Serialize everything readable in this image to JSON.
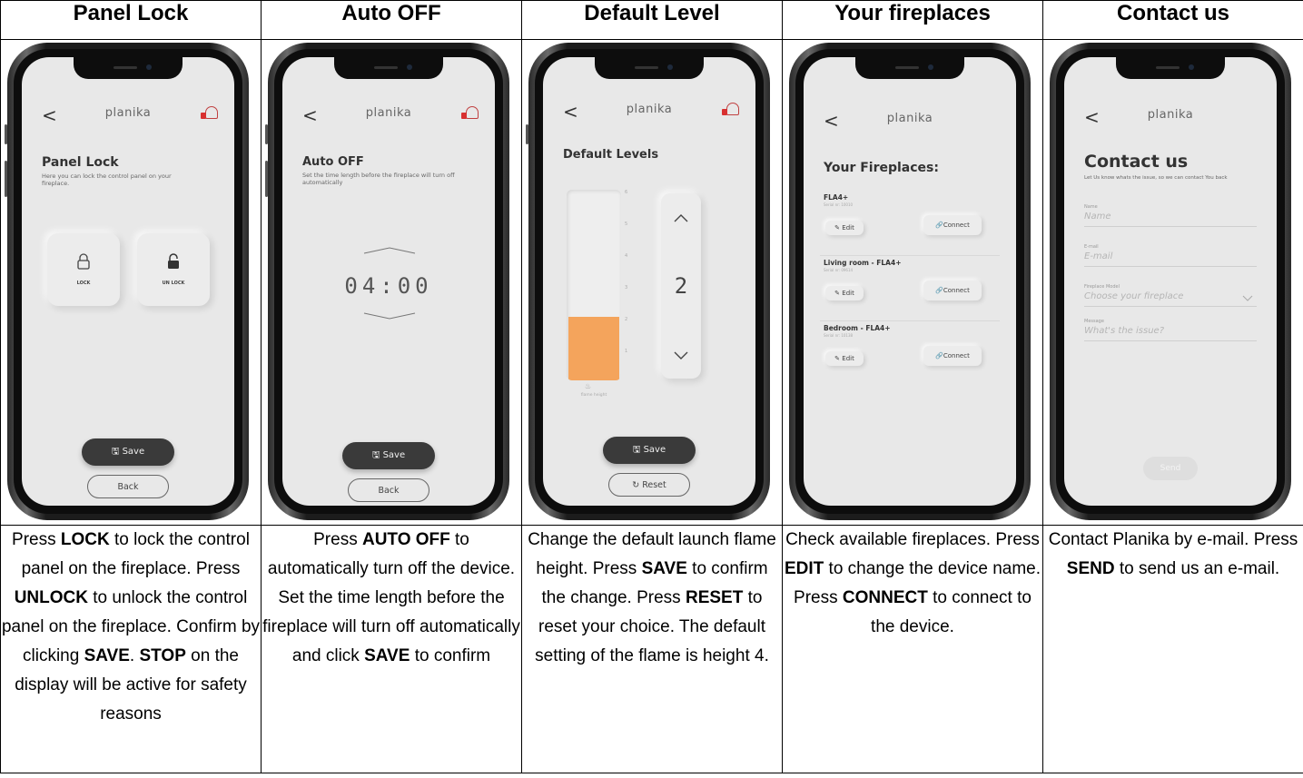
{
  "headers": [
    "Panel Lock",
    "Auto OFF",
    "Default Level",
    "Your fireplaces",
    "Contact us"
  ],
  "app": {
    "brand": "planika",
    "back_glyph": "<"
  },
  "panel_lock": {
    "title": "Panel Lock",
    "subtitle": "Here you can lock the control panel on your fireplace.",
    "lock_label": "LOCK",
    "unlock_label": "UN LOCK",
    "save": "Save",
    "back": "Back"
  },
  "auto_off": {
    "title": "Auto OFF",
    "subtitle": "Set the time length before the fireplace will turn off automatically",
    "time": "04:00",
    "save": "Save",
    "back": "Back"
  },
  "default_level": {
    "title": "Default Levels",
    "scale_ticks": [
      "6",
      "5",
      "4",
      "3",
      "2",
      "1"
    ],
    "fill_level": 2,
    "max_level": 6,
    "value": "2",
    "bar_caption": "flame height",
    "save": "Save",
    "reset": "Reset"
  },
  "fireplaces": {
    "title": "Your Fireplaces:",
    "items": [
      {
        "name": "FLA4+",
        "serial": "Serial nr: 10010",
        "edit": "Edit",
        "connect": "Connect"
      },
      {
        "name": "Living room - FLA4+",
        "serial": "Serial nr: 09614",
        "edit": "Edit",
        "connect": "Connect"
      },
      {
        "name": "Bedroom - FLA4+",
        "serial": "Serial nr: 10138",
        "edit": "Edit",
        "connect": "Connect"
      }
    ]
  },
  "contact": {
    "title": "Contact us",
    "subtitle": "Let Us know whats the issue, so we can contact You back",
    "fields": [
      {
        "label": "Name",
        "placeholder": "Name"
      },
      {
        "label": "E-mail",
        "placeholder": "E-mail"
      },
      {
        "label": "Fireplace Model",
        "placeholder": "Choose your fireplace"
      },
      {
        "label": "Message",
        "placeholder": "What's the issue?"
      }
    ],
    "send": "Send"
  },
  "descriptions": {
    "panel_lock": [
      {
        "t": "Press "
      },
      {
        "b": "LOCK"
      },
      {
        "t": " to lock the control panel on the fireplace. Press "
      },
      {
        "b": "UNLOCK"
      },
      {
        "t": " to unlock the control panel on the fireplace. Confirm by clicking "
      },
      {
        "b": "SAVE"
      },
      {
        "t": ". "
      },
      {
        "b": "STOP"
      },
      {
        "t": " on the display will be active for safety reasons"
      }
    ],
    "auto_off": [
      {
        "t": "Press "
      },
      {
        "b": "AUTO OFF"
      },
      {
        "t": " to automatically turn off the device. Set the time length before the fireplace will turn off automatically and click "
      },
      {
        "b": "SAVE"
      },
      {
        "t": " to confirm"
      }
    ],
    "default_level": [
      {
        "t": "Change the default launch flame height. Press "
      },
      {
        "b": "SAVE"
      },
      {
        "t": " to confirm the change. Press "
      },
      {
        "b": "RESET"
      },
      {
        "t": " to reset your choice. The default setting of the flame is height 4."
      }
    ],
    "fireplaces": [
      {
        "t": "Check available fireplaces. Press "
      },
      {
        "b": "EDIT"
      },
      {
        "t": " to change the device name. Press "
      },
      {
        "b": "CONNECT"
      },
      {
        "t": " to connect to the device."
      }
    ],
    "contact": [
      {
        "t": "Contact Planika by e-mail. Press "
      },
      {
        "b": "SEND"
      },
      {
        "t": " to send us an e-mail."
      }
    ]
  },
  "colors": {
    "flame_fill": "#f4a45c",
    "dark_button": "#3a3a3a",
    "screen_bg": "#e8e8e8",
    "bell_red": "#d83030"
  }
}
